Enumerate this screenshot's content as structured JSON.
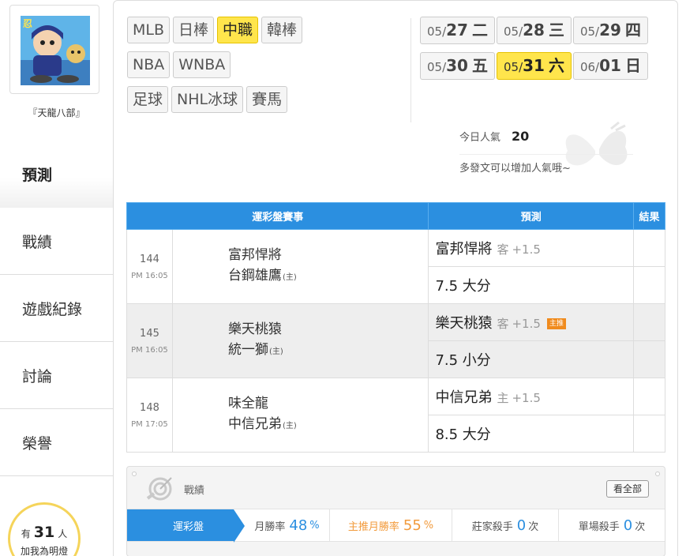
{
  "user": {
    "name": "『天龍八部』"
  },
  "nav": [
    {
      "label": "預測",
      "active": true
    },
    {
      "label": "戰績"
    },
    {
      "label": "遊戲紀錄"
    },
    {
      "label": "討論"
    },
    {
      "label": "榮譽"
    }
  ],
  "lamp": {
    "prefix": "有",
    "count": "31",
    "suffix": "人",
    "text": "加我為明燈"
  },
  "leagues": [
    {
      "label": "MLB"
    },
    {
      "label": "日棒"
    },
    {
      "label": "中職",
      "active": true
    },
    {
      "label": "韓棒"
    },
    {
      "label": "NBA"
    },
    {
      "label": "WNBA"
    },
    {
      "label": "足球"
    },
    {
      "label": "NHL冰球"
    },
    {
      "label": "賽馬"
    }
  ],
  "dates": [
    {
      "mm": "05/",
      "dd": "27",
      "wk": "二"
    },
    {
      "mm": "05/",
      "dd": "28",
      "wk": "三"
    },
    {
      "mm": "05/",
      "dd": "29",
      "wk": "四"
    },
    {
      "mm": "05/",
      "dd": "30",
      "wk": "五"
    },
    {
      "mm": "05/",
      "dd": "31",
      "wk": "六",
      "active": true
    },
    {
      "mm": "06/",
      "dd": "01",
      "wk": "日"
    }
  ],
  "popularity": {
    "label": "今日人氣",
    "value": "20",
    "hint": "多發文可以增加人氣哦~"
  },
  "table": {
    "headers": {
      "game": "運彩盤賽事",
      "pick": "預測",
      "result": "結果"
    },
    "rows": [
      {
        "no": "144",
        "time": "PM 16:05",
        "away": "富邦悍將",
        "home": "台鋼雄鷹",
        "home_mark": "(主)",
        "pick1_team": "富邦悍將",
        "pick1_side": "客",
        "pick1_line": "+1.5",
        "pick1_badge": "",
        "pick2": "7.5 大分"
      },
      {
        "no": "145",
        "time": "PM 16:05",
        "away": "樂天桃猿",
        "home": "統一獅",
        "home_mark": "(主)",
        "pick1_team": "樂天桃猿",
        "pick1_side": "客",
        "pick1_line": "+1.5",
        "pick1_badge": "主推",
        "pick2": "7.5 小分"
      },
      {
        "no": "148",
        "time": "PM 17:05",
        "away": "味全龍",
        "home": "中信兄弟",
        "home_mark": "(主)",
        "pick1_team": "中信兄弟",
        "pick1_side": "主",
        "pick1_line": "+1.5",
        "pick1_badge": "",
        "pick2": "8.5 大分"
      }
    ]
  },
  "stats": {
    "title": "戰績",
    "see_all": "看全部",
    "tab": "運彩盤",
    "month_label": "月勝率",
    "month_value": "48",
    "month_unit": "%",
    "main_label": "主推月勝率",
    "main_value": "55",
    "main_unit": "%",
    "banker_label": "莊家殺手",
    "banker_value": "0",
    "banker_unit": "次",
    "single_label": "單場殺手",
    "single_value": "0",
    "single_unit": "次"
  },
  "colors": {
    "accent": "#2b8fe0",
    "highlight": "#ffe54c",
    "badge": "#f08b1e",
    "orange": "#f29a3b"
  }
}
